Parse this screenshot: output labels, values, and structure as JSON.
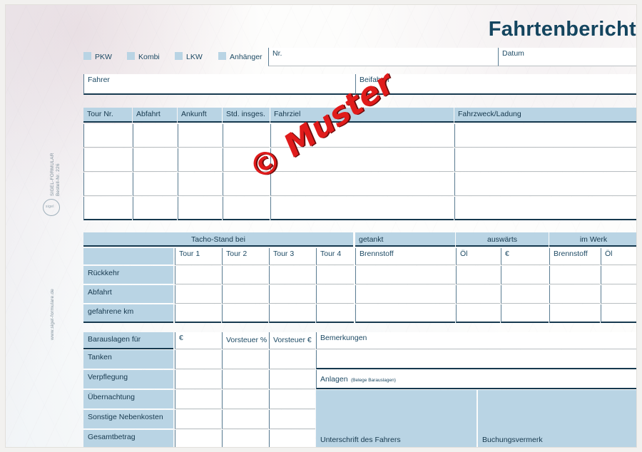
{
  "document": {
    "title": "Fahrtenbericht",
    "watermark": "© Muster"
  },
  "side": {
    "brand_line1": "SIGEL-FORMULAR",
    "brand_line2": "Bestell-Nr. 226",
    "logo_text": "sigel",
    "website": "www.sigel-formulare.de"
  },
  "vehicle_types": [
    {
      "label": "PKW"
    },
    {
      "label": "Kombi"
    },
    {
      "label": "LKW"
    },
    {
      "label": "Anhänger"
    }
  ],
  "header_fields": {
    "nr_label": "Nr.",
    "nr_value": "",
    "datum_label": "Datum",
    "datum_value": "",
    "fahrer_label": "Fahrer",
    "fahrer_value": "",
    "beifahrer_label": "Beifahrer",
    "beifahrer_value": ""
  },
  "tour_table": {
    "columns": [
      {
        "label": "Tour Nr."
      },
      {
        "label": "Abfahrt"
      },
      {
        "label": "Ankunft"
      },
      {
        "label": "Std. insges."
      },
      {
        "label": "Fahrziel"
      },
      {
        "label": "Fahrzweck/Ladung"
      }
    ],
    "row_count": 4
  },
  "tacho_section": {
    "group_headers": [
      {
        "label": "Tacho-Stand bei"
      },
      {
        "label": "getankt"
      },
      {
        "label": "auswärts"
      },
      {
        "label": "im Werk"
      }
    ],
    "columns": [
      {
        "label": ""
      },
      {
        "label": "Tour 1"
      },
      {
        "label": "Tour 2"
      },
      {
        "label": "Tour 3"
      },
      {
        "label": "Tour 4"
      },
      {
        "label": "Brennstoff"
      },
      {
        "label": "Öl"
      },
      {
        "label": "€"
      },
      {
        "label": "Brennstoff"
      },
      {
        "label": "Öl"
      }
    ],
    "rows": [
      {
        "label": "Rückkehr"
      },
      {
        "label": "Abfahrt"
      },
      {
        "label": "gefahrene km"
      }
    ]
  },
  "expense_section": {
    "columns": [
      {
        "label": "Barauslagen für"
      },
      {
        "label": "€"
      },
      {
        "label": "Vorsteuer %"
      },
      {
        "label": "Vorsteuer €"
      }
    ],
    "rows": [
      {
        "label": "Tanken"
      },
      {
        "label": "Verpflegung"
      },
      {
        "label": "Übernachtung"
      },
      {
        "label": "Sonstige Nebenkosten"
      },
      {
        "label": "Gesamtbetrag"
      }
    ]
  },
  "notes_section": {
    "bemerkungen_label": "Bemerkungen",
    "bemerkungen_value": "",
    "anlagen_label": "Anlagen",
    "anlagen_hint": "(Belege Barauslagen)",
    "signature_label": "Unterschrift des Fahrers",
    "booking_label": "Buchungsvermerk"
  },
  "colors": {
    "field_blue": "#b9d4e4",
    "ink": "#16384d",
    "rule": "#16394f",
    "watermark_red": "#e01b1b"
  }
}
